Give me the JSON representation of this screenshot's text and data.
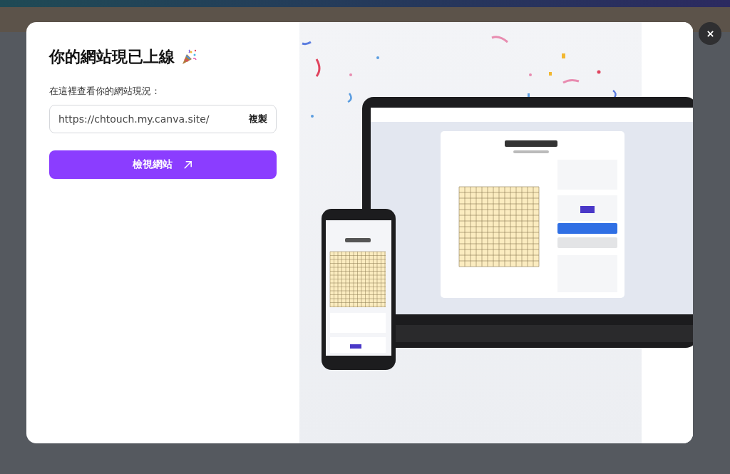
{
  "dialog": {
    "title": "你的網站現已上線",
    "prompt": "在這裡查看你的網站現況：",
    "url_field": {
      "value": "https://chtouch.my.canva.site/",
      "copy_button": "複製"
    },
    "view_button": "檢視網站"
  }
}
